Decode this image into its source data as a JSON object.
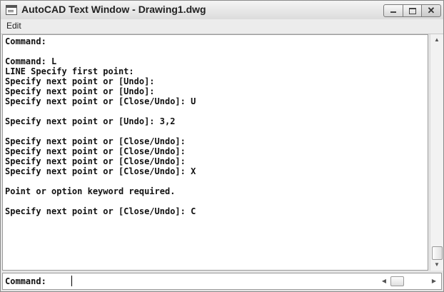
{
  "window": {
    "title": "AutoCAD Text Window - Drawing1.dwg",
    "icon": "text-window-icon",
    "buttons": [
      "minimize-icon",
      "maximize-icon",
      "close-icon"
    ],
    "close_glyph": "✕"
  },
  "menu": {
    "edit_label": "Edit"
  },
  "history": {
    "lines": [
      "Command:",
      "",
      "Command: L",
      "LINE Specify first point:",
      "Specify next point or [Undo]:",
      "Specify next point or [Undo]:",
      "Specify next point or [Close/Undo]: U",
      "",
      "Specify next point or [Undo]: 3,2",
      "",
      "Specify next point or [Close/Undo]:",
      "Specify next point or [Close/Undo]:",
      "Specify next point or [Close/Undo]:",
      "Specify next point or [Close/Undo]: X",
      "",
      "Point or option keyword required.",
      "",
      "Specify next point or [Close/Undo]: C"
    ]
  },
  "command_line": {
    "prompt": "Command:",
    "value": ""
  },
  "scrollbars": {
    "up_arrow": "▲",
    "down_arrow": "▼",
    "left_arrow": "◀",
    "right_arrow": "▶"
  }
}
